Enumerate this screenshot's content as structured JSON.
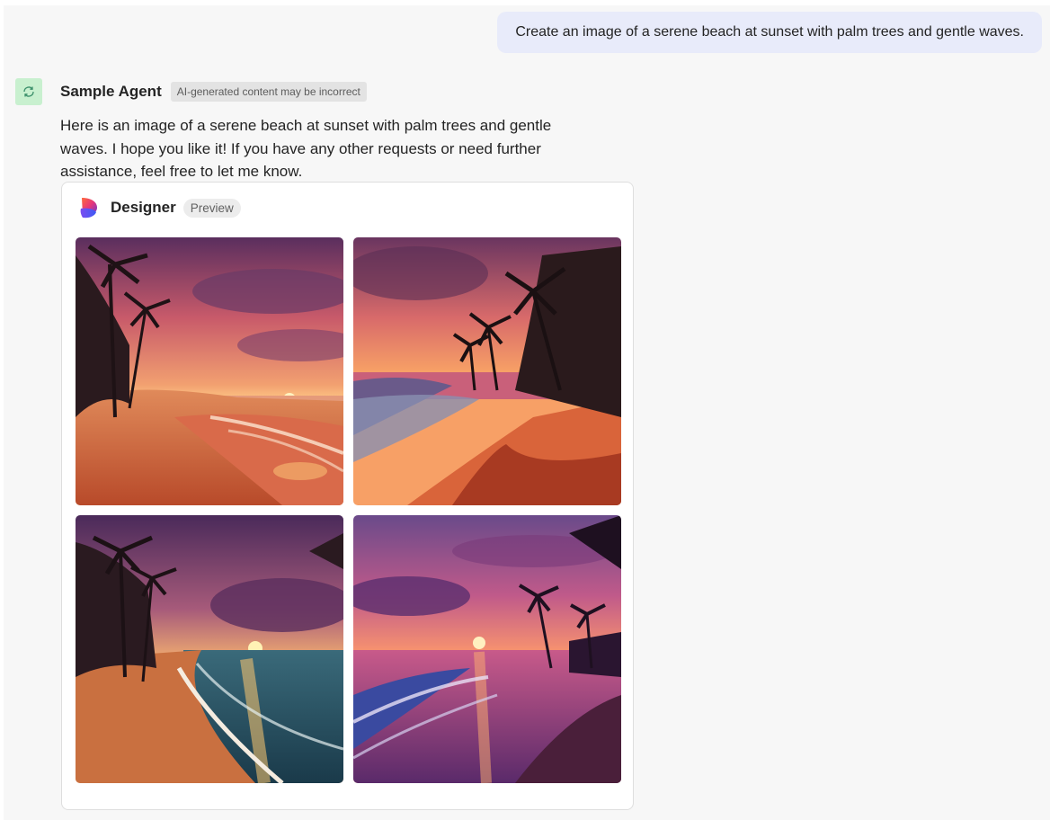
{
  "user_message": "Create an image of a serene beach at sunset with palm trees and gentle waves.",
  "agent": {
    "name": "Sample Agent",
    "badge": "AI-generated content may be incorrect",
    "avatar_icon": "sync-loop-icon",
    "message": "Here is an image of a serene beach at sunset with palm trees and gentle waves. I hope you like it! If you have any other requests or need further assistance, feel free to let me know."
  },
  "designer_card": {
    "title": "Designer",
    "badge": "Preview",
    "logo_icon": "designer-logo-icon",
    "images_count_shown": 4
  },
  "colors": {
    "user_bubble": "#e8ebfa",
    "avatar_bg": "#c8f0cf",
    "pane_bg": "#f7f7f7",
    "card_border": "#dedede"
  }
}
